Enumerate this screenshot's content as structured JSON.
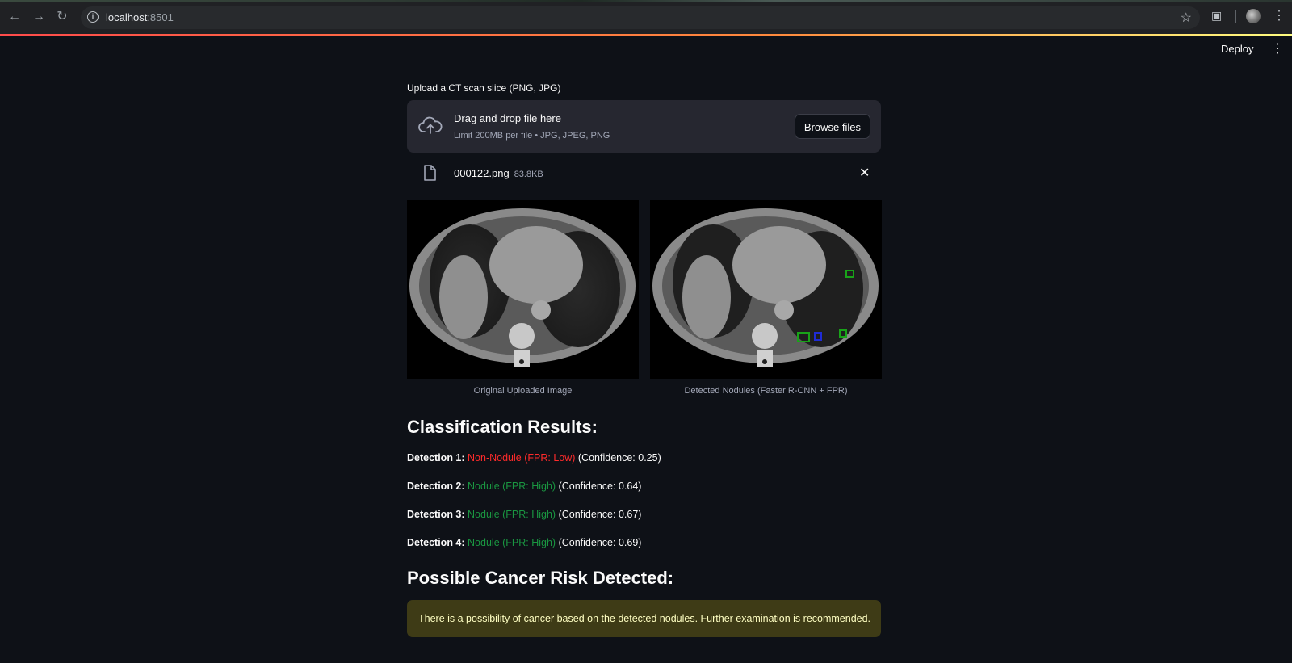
{
  "browser": {
    "url_host": "localhost",
    "url_port": ":8501"
  },
  "app": {
    "deploy_label": "Deploy"
  },
  "uploader": {
    "label": "Upload a CT scan slice (PNG, JPG)",
    "drop_title": "Drag and drop file here",
    "drop_limit": "Limit 200MB per file • JPG, JPEG, PNG",
    "browse_label": "Browse files",
    "file": {
      "name": "000122.png",
      "size": "83.8KB"
    }
  },
  "images": {
    "original_caption": "Original Uploaded Image",
    "detected_caption": "Detected Nodules (Faster R-CNN + FPR)"
  },
  "results": {
    "heading": "Classification Results:",
    "detections": [
      {
        "label": "Detection 1:",
        "class": "Non-Nodule (FPR: Low)",
        "confidence": "(Confidence: 0.25)",
        "color": "#ff2b2b"
      },
      {
        "label": "Detection 2:",
        "class": "Nodule (FPR: High)",
        "confidence": "(Confidence: 0.64)",
        "color": "#1a9641"
      },
      {
        "label": "Detection 3:",
        "class": "Nodule (FPR: High)",
        "confidence": "(Confidence: 0.67)",
        "color": "#1a9641"
      },
      {
        "label": "Detection 4:",
        "class": "Nodule (FPR: High)",
        "confidence": "(Confidence: 0.69)",
        "color": "#1a9641"
      }
    ]
  },
  "risk": {
    "heading": "Possible Cancer Risk Detected:",
    "message": "There is a possibility of cancer based on the detected nodules. Further examination is recommended."
  },
  "colors": {
    "background": "#0e1117",
    "panel": "#262730",
    "warning_bg": "#3e3b16",
    "warning_text": "#ffffc2",
    "box_green": "#19a319",
    "box_blue": "#1f2bd6"
  }
}
